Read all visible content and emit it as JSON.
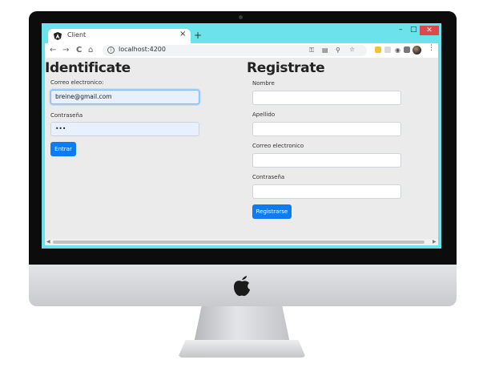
{
  "browser": {
    "tab_title": "Client",
    "new_tab": "+",
    "tab_close": "×",
    "url": "localhost:4200",
    "window": {
      "minimize": "–",
      "maximize": "□",
      "close": "✕"
    },
    "nav": {
      "back": "←",
      "forward": "→",
      "reload": "C",
      "home": "⌂"
    }
  },
  "login": {
    "title": "Identificate",
    "email_label": "Correo electronico:",
    "email_value": "breine@gmail.com",
    "password_label": "Contraseña",
    "password_value": "•••",
    "submit_label": "Entrar"
  },
  "register": {
    "title": "Registrate",
    "name_label": "Nombre",
    "surname_label": "Apellido",
    "email_label": "Correo electronico",
    "password_label": "Contraseña",
    "submit_label": "Registrarse"
  },
  "colors": {
    "primary": "#0d7cf2",
    "browser_frame": "#6ce3ea",
    "page_background": "#ebebeb"
  }
}
